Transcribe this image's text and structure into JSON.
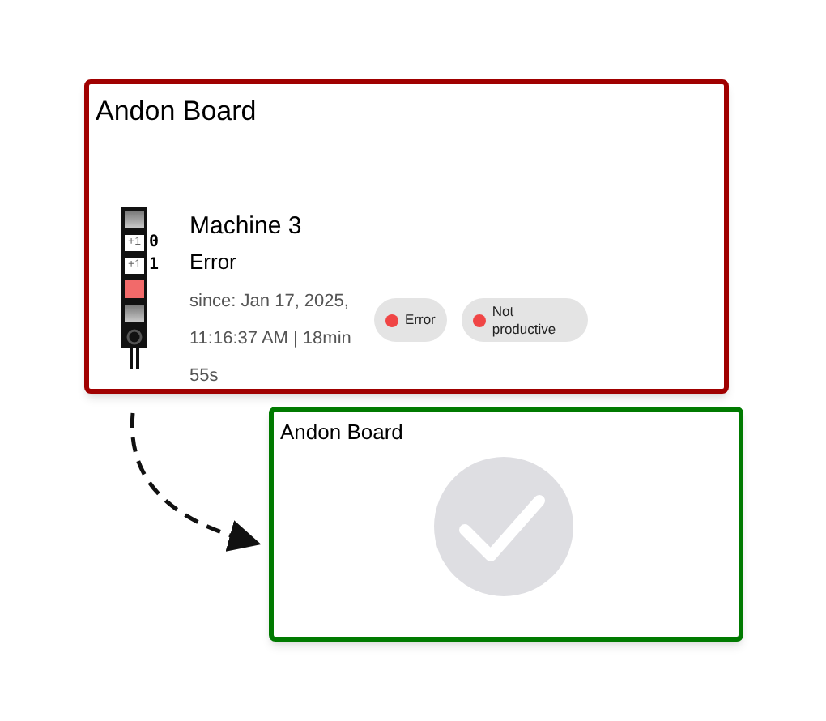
{
  "cards": [
    {
      "title": "Andon Board",
      "kind": "alert",
      "machine": {
        "name": "Machine 3",
        "state": "Error",
        "since": "since: Jan 17, 2025, 11:16:37 AM | 18min 55s"
      },
      "stack_light": [
        {
          "kind": "lamp",
          "on": false
        },
        {
          "kind": "counter",
          "label": "+1",
          "value": "0"
        },
        {
          "kind": "counter",
          "label": "+1",
          "value": "1"
        },
        {
          "kind": "lamp",
          "on": true
        },
        {
          "kind": "lamp",
          "on": false
        }
      ],
      "badges": [
        {
          "label": "Error",
          "color": "#f04545"
        },
        {
          "label": "Not productive",
          "color": "#f04545"
        }
      ]
    },
    {
      "title": "Andon Board",
      "kind": "clear"
    }
  ]
}
